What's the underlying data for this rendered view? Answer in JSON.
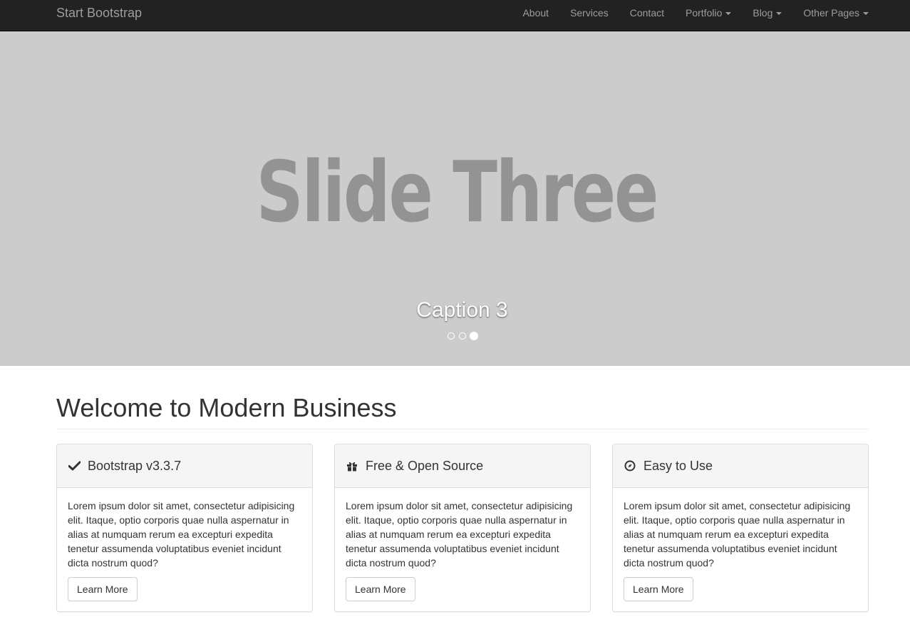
{
  "navbar": {
    "brand": "Start Bootstrap",
    "items": [
      {
        "label": "About",
        "dropdown": false
      },
      {
        "label": "Services",
        "dropdown": false
      },
      {
        "label": "Contact",
        "dropdown": false
      },
      {
        "label": "Portfolio",
        "dropdown": true
      },
      {
        "label": "Blog",
        "dropdown": true
      },
      {
        "label": "Other Pages",
        "dropdown": true
      }
    ]
  },
  "carousel": {
    "slide_text": "Slide Three",
    "caption": "Caption 3",
    "indicators": 3,
    "active_index": 2
  },
  "main": {
    "heading": "Welcome to Modern Business",
    "panels": [
      {
        "icon": "check-icon",
        "title": "Bootstrap v3.3.7",
        "body": "Lorem ipsum dolor sit amet, consectetur adipisicing elit. Itaque, optio corporis quae nulla aspernatur in alias at numquam rerum ea excepturi expedita tenetur assumenda voluptatibus eveniet incidunt dicta nostrum quod?",
        "button": "Learn More"
      },
      {
        "icon": "gift-icon",
        "title": "Free & Open Source",
        "body": "Lorem ipsum dolor sit amet, consectetur adipisicing elit. Itaque, optio corporis quae nulla aspernatur in alias at numquam rerum ea excepturi expedita tenetur assumenda voluptatibus eveniet incidunt dicta nostrum quod?",
        "button": "Learn More"
      },
      {
        "icon": "compass-icon",
        "title": "Easy to Use",
        "body": "Lorem ipsum dolor sit amet, consectetur adipisicing elit. Itaque, optio corporis quae nulla aspernatur in alias at numquam rerum ea excepturi expedita tenetur assumenda voluptatibus eveniet incidunt dicta nostrum quod?",
        "button": "Learn More"
      }
    ]
  },
  "colors": {
    "navbar_bg": "#222222",
    "nav_text": "#9d9d9d",
    "carousel_bg": "#cccccc",
    "slide_text": "#939393",
    "panel_heading_bg": "#f5f5f5",
    "border": "#dddddd"
  }
}
